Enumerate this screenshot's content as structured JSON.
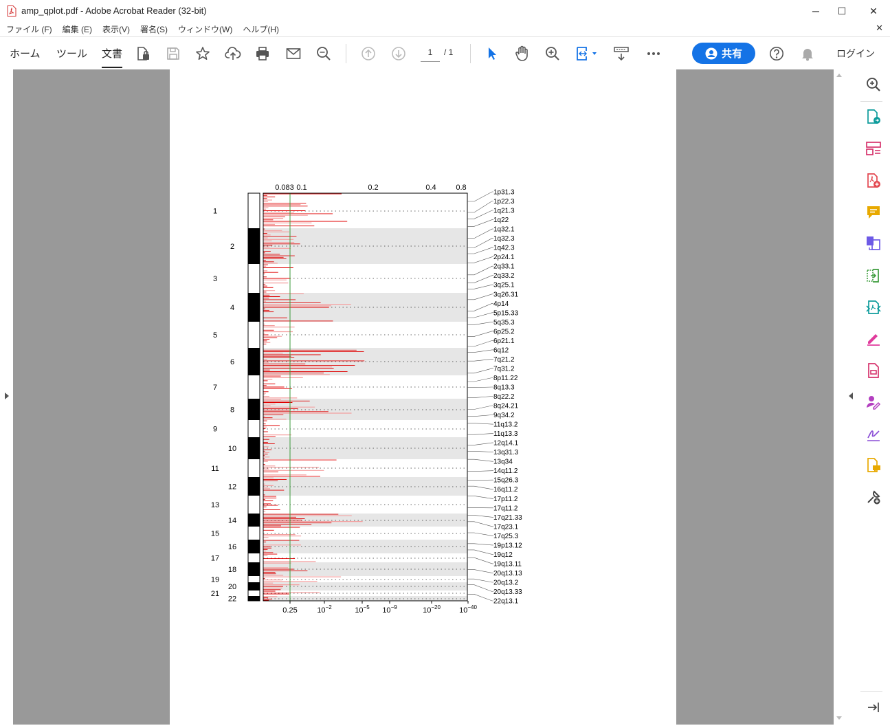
{
  "window": {
    "title": "amp_qplot.pdf - Adobe Acrobat Reader (32-bit)",
    "minimize": "─",
    "maximize": "☐",
    "close": "✕"
  },
  "menu": [
    "ファイル (F)",
    "編集 (E)",
    "表示(V)",
    "署名(S)",
    "ウィンドウ(W)",
    "ヘルプ(H)"
  ],
  "toolbar": {
    "tabs": [
      "ホーム",
      "ツール",
      "文書"
    ],
    "page_current": "1",
    "page_total": "/ 1",
    "share_label": "共有",
    "login_label": "ログイン"
  },
  "chart_data": {
    "type": "bar",
    "top_axis_ticks": [
      "0.083",
      "0.1",
      "0.2",
      "0.4",
      "0.8"
    ],
    "bottom_axis_ticks": [
      {
        "base": "0.25",
        "exp": ""
      },
      {
        "base": "10",
        "exp": "−2"
      },
      {
        "base": "10",
        "exp": "−5"
      },
      {
        "base": "10",
        "exp": "−9"
      },
      {
        "base": "10",
        "exp": "−20"
      },
      {
        "base": "10",
        "exp": "−40"
      }
    ],
    "chromosome_labels": [
      "1",
      "2",
      "3",
      "4",
      "5",
      "6",
      "7",
      "8",
      "9",
      "10",
      "11",
      "12",
      "13",
      "14",
      "15",
      "16",
      "17",
      "18",
      "19",
      "20",
      "21",
      "22"
    ],
    "peak_labels": [
      "1p31.3",
      "1p22.3",
      "1q21.3",
      "1q22",
      "1q32.1",
      "1q32.3",
      "1q42.3",
      "2p24.1",
      "2q33.1",
      "2q33.2",
      "3q25.1",
      "3q26.31",
      "4p14",
      "5p15.33",
      "5q35.3",
      "6p25.2",
      "6p21.1",
      "6q12",
      "7q21.2",
      "7q31.2",
      "8p11.22",
      "8q13.3",
      "8q22.2",
      "8q24.21",
      "9q34.2",
      "11q13.2",
      "11q13.3",
      "12q14.1",
      "13q31.3",
      "13q34",
      "14q11.2",
      "15q26.3",
      "16q11.2",
      "17p11.2",
      "17q11.2",
      "17q21.33",
      "17q23.1",
      "17q25.3",
      "19p13.12",
      "19q12",
      "19q13.11",
      "20q13.13",
      "20q13.2",
      "20q13.33",
      "22q13.1"
    ],
    "threshold_q": 0.25
  }
}
